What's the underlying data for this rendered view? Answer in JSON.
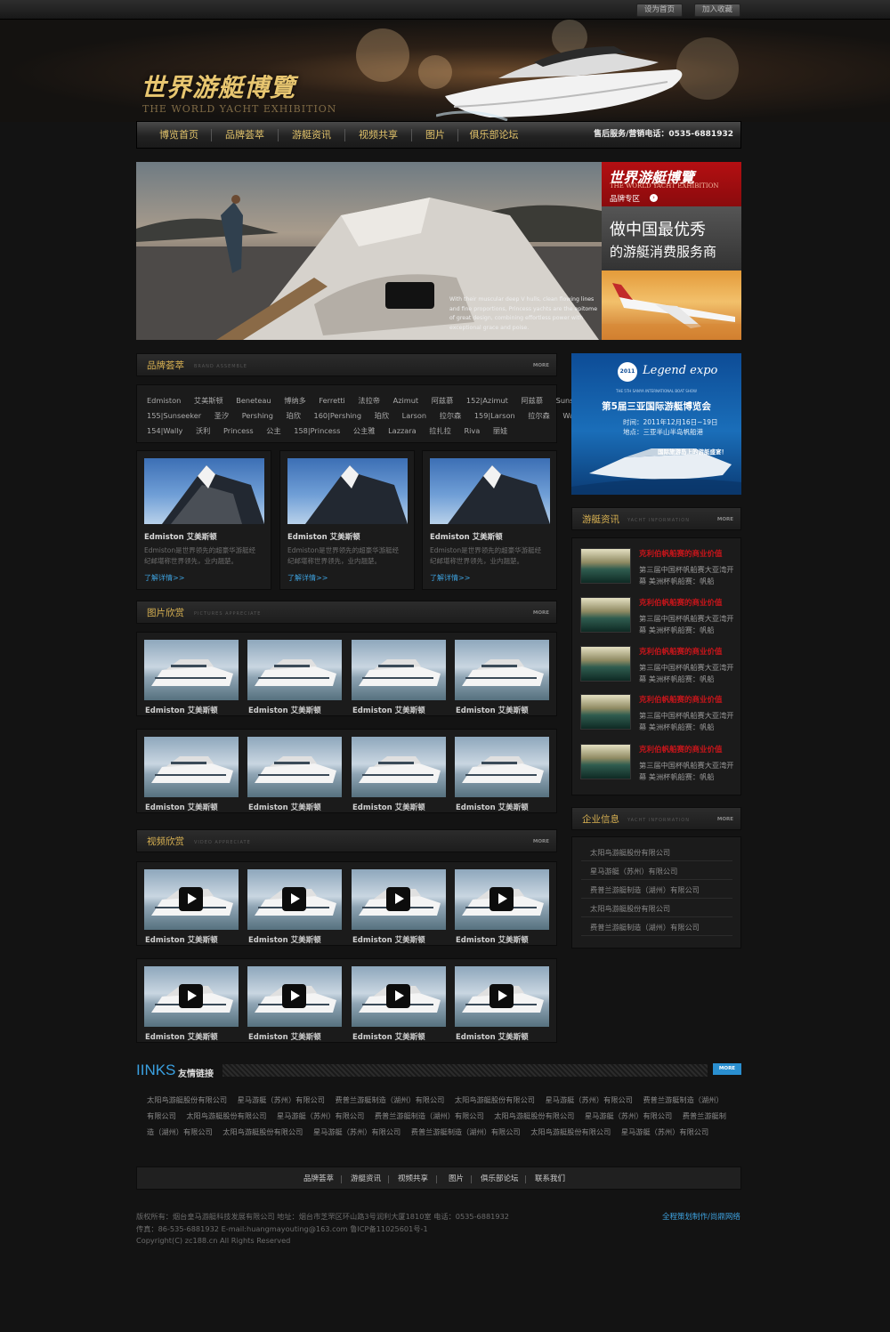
{
  "topbar": {
    "set_home": "设为首页",
    "add_fav": "加入收藏"
  },
  "logo": {
    "cn": "世界游艇博覽",
    "en": "THE WORLD YACHT EXHIBITION"
  },
  "nav": {
    "items": [
      "博览首页",
      "品牌荟萃",
      "游艇资讯",
      "视频共享",
      "图片",
      "俱乐部论坛"
    ],
    "phone": "售后服务/营销电话：0535-6881932"
  },
  "banner": {
    "caption": [
      "With their muscular deep V hulls, clean flowing lines",
      "and fine proportions, Princess yachts are the epitome",
      "of great design, combining effortless power with",
      "exceptional grace and poise."
    ]
  },
  "side": {
    "logo_cn": "世界游艇博覽",
    "logo_en": "THE WORLD YACHT EXHIBITION",
    "zone": "品牌专区",
    "slogan1": "做中国最优秀",
    "slogan2": "的游艇消费服务商"
  },
  "brands": {
    "title": "品牌荟萃",
    "sub": "BRAND ASSEMBLE",
    "more": "MORE",
    "rows": [
      [
        "Edmiston 艾美斯顿",
        "Beneteau 博纳多",
        "Ferretti 法拉帝",
        "Azimut 阿兹慕",
        "152|Azimut 阿兹慕",
        "Sunseeker 圣汐"
      ],
      [
        "155|Sunseeker 圣汐",
        "Pershing 珀欣",
        "160|Pershing 珀欣",
        "Larson 拉尔森",
        "159|Larson 拉尔森",
        "Wally 沃利"
      ],
      [
        "154|Wally 沃利",
        "Princess 公主",
        "158|Princess 公主雅",
        "Lazzara 拉扎拉",
        "Riva 丽娃"
      ]
    ],
    "cards": [
      {
        "title": "Edmiston 艾美斯顿",
        "desc": [
          "Edmiston是世界领先的超豪华游艇经",
          "纪邮堪称世界领先，业内翘楚。"
        ],
        "more": "了解详情>>"
      },
      {
        "title": "Edmiston 艾美斯顿",
        "desc": [
          "Edmiston是世界领先的超豪华游艇经",
          "纪邮堪称世界领先，业内翘楚。"
        ],
        "more": "了解详情>>"
      },
      {
        "title": "Edmiston 艾美斯顿",
        "desc": [
          "Edmiston是世界领先的超豪华游艇经",
          "纪邮堪称世界领先，业内翘楚。"
        ],
        "more": "了解详情>>"
      }
    ]
  },
  "pictures": {
    "title": "图片欣赏",
    "sub": "PICTURES APPRECIATE",
    "more": "MORE",
    "item_name": "Edmiston 艾美斯顿"
  },
  "videos": {
    "title": "视频欣赏",
    "sub": "VIDEO APPRECIATE",
    "more": "MORE",
    "item_name": "Edmiston 艾美斯顿"
  },
  "ad": {
    "logo": "Legend expo",
    "year": "2011",
    "line_en": "THE 5TH SANYA INTERNATIONAL BOAT SHOW",
    "title": "第5届三亚国际游艇博览会",
    "time": "时间：2011年12月16日~19日",
    "place": "地点：三亚半山半岛帆船港",
    "slogan": "国际旅游岛上的游艇盛宴！"
  },
  "news": {
    "title": "游艇资讯",
    "sub": "YACHT INFORMATION",
    "more": "MORE",
    "items": [
      {
        "title": "克利伯帆船赛的商业价值",
        "desc": "第三届中国杯帆船赛大亚湾开幕 美洲杯帆船赛：帆船"
      },
      {
        "title": "克利伯帆船赛的商业价值",
        "desc": "第三届中国杯帆船赛大亚湾开幕 美洲杯帆船赛：帆船"
      },
      {
        "title": "克利伯帆船赛的商业价值",
        "desc": "第三届中国杯帆船赛大亚湾开幕 美洲杯帆船赛：帆船"
      },
      {
        "title": "克利伯帆船赛的商业价值",
        "desc": "第三届中国杯帆船赛大亚湾开幕 美洲杯帆船赛：帆船"
      },
      {
        "title": "克利伯帆船赛的商业价值",
        "desc": "第三届中国杯帆船赛大亚湾开幕 美洲杯帆船赛：帆船"
      }
    ]
  },
  "companies": {
    "title": "企业信息",
    "sub": "YACHT INFORMATION",
    "more": "MORE",
    "items": [
      "太阳鸟游艇股份有限公司",
      "星马游艇（苏州）有限公司",
      "费普兰游艇制造（湖州）有限公司",
      "太阳鸟游艇股份有限公司",
      "费普兰游艇制造（湖州）有限公司"
    ]
  },
  "links": {
    "title": "IINKS",
    "cn": "友情链接",
    "more": "MORE",
    "rows": [
      "太阳鸟游艇股份有限公司 星马游艇（苏州）有限公司 费普兰游艇制造（湖州）有限公司 太阳鸟游艇股份有限公司 星马游艇（苏州）有限公司 费普兰游艇制造（湖州）",
      "有限公司 太阳鸟游艇股份有限公司 星马游艇（苏州）有限公司 费普兰游艇制造（湖州）有限公司 太阳鸟游艇股份有限公司 星马游艇（苏州）有限公司 费普兰游艇制",
      "造（湖州）有限公司 太阳鸟游艇股份有限公司 星马游艇（苏州）有限公司 费普兰游艇制造（湖州）有限公司 太阳鸟游艇股份有限公司 星马游艇（苏州）有限公司"
    ]
  },
  "footer": {
    "nav": [
      "品牌荟萃",
      "游艇资讯",
      "视频共享",
      "图片",
      "俱乐部论坛",
      "联系我们"
    ],
    "line1": "版权所有：烟台皇马游艇科技发展有限公司    地址：烟台市芝罘区环山路3号润利大厦1810室    电话：0535-6881932",
    "line2": "传真：86-535-6881932  E-mail:huangmayouting@163.com 鲁ICP备11025601号-1",
    "line3": "Copyright(C) zc188.cn All Rights Reserved",
    "credit": "全程策划制作/尚鼎网络"
  }
}
